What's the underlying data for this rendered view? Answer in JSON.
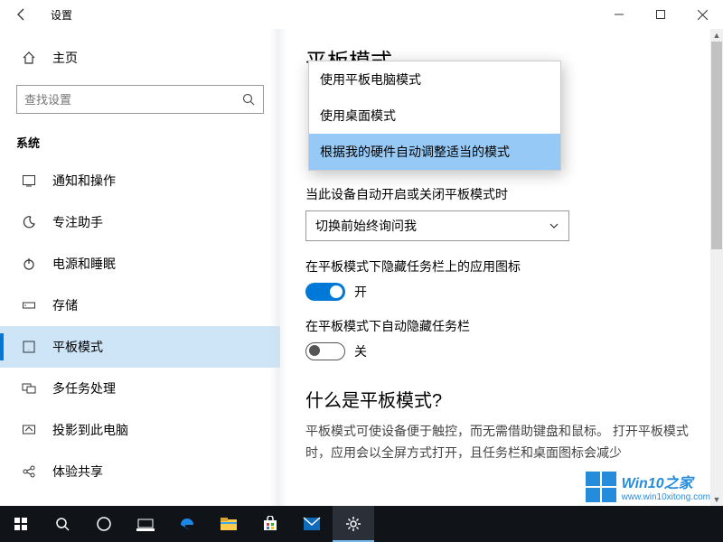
{
  "window": {
    "title": "设置"
  },
  "sidebar": {
    "home": "主页",
    "search_placeholder": "查找设置",
    "category": "系统",
    "items": [
      {
        "label": "通知和操作"
      },
      {
        "label": "专注助手"
      },
      {
        "label": "电源和睡眠"
      },
      {
        "label": "存储"
      },
      {
        "label": "平板模式"
      },
      {
        "label": "多任务处理"
      },
      {
        "label": "投影到此电脑"
      },
      {
        "label": "体验共享"
      }
    ]
  },
  "main": {
    "page_title": "平板模式",
    "dropdown_options": [
      "使用平板电脑模式",
      "使用桌面模式",
      "根据我的硬件自动调整适当的模式"
    ],
    "section1_label": "当此设备自动开启或关闭平板模式时",
    "section1_value": "切换前始终询问我",
    "section2_label": "在平板模式下隐藏任务栏上的应用图标",
    "section2_state": "开",
    "section3_label": "在平板模式下自动隐藏任务栏",
    "section3_state": "关",
    "about_heading": "什么是平板模式?",
    "about_body": "平板模式可使设备便于触控，而无需借助键盘和鼠标。 打开平板模式时，应用会以全屏方式打开，且任务栏和桌面图标会减少"
  },
  "watermark": {
    "line1": "Win10之家",
    "line2": "www.win10xitong.com"
  }
}
